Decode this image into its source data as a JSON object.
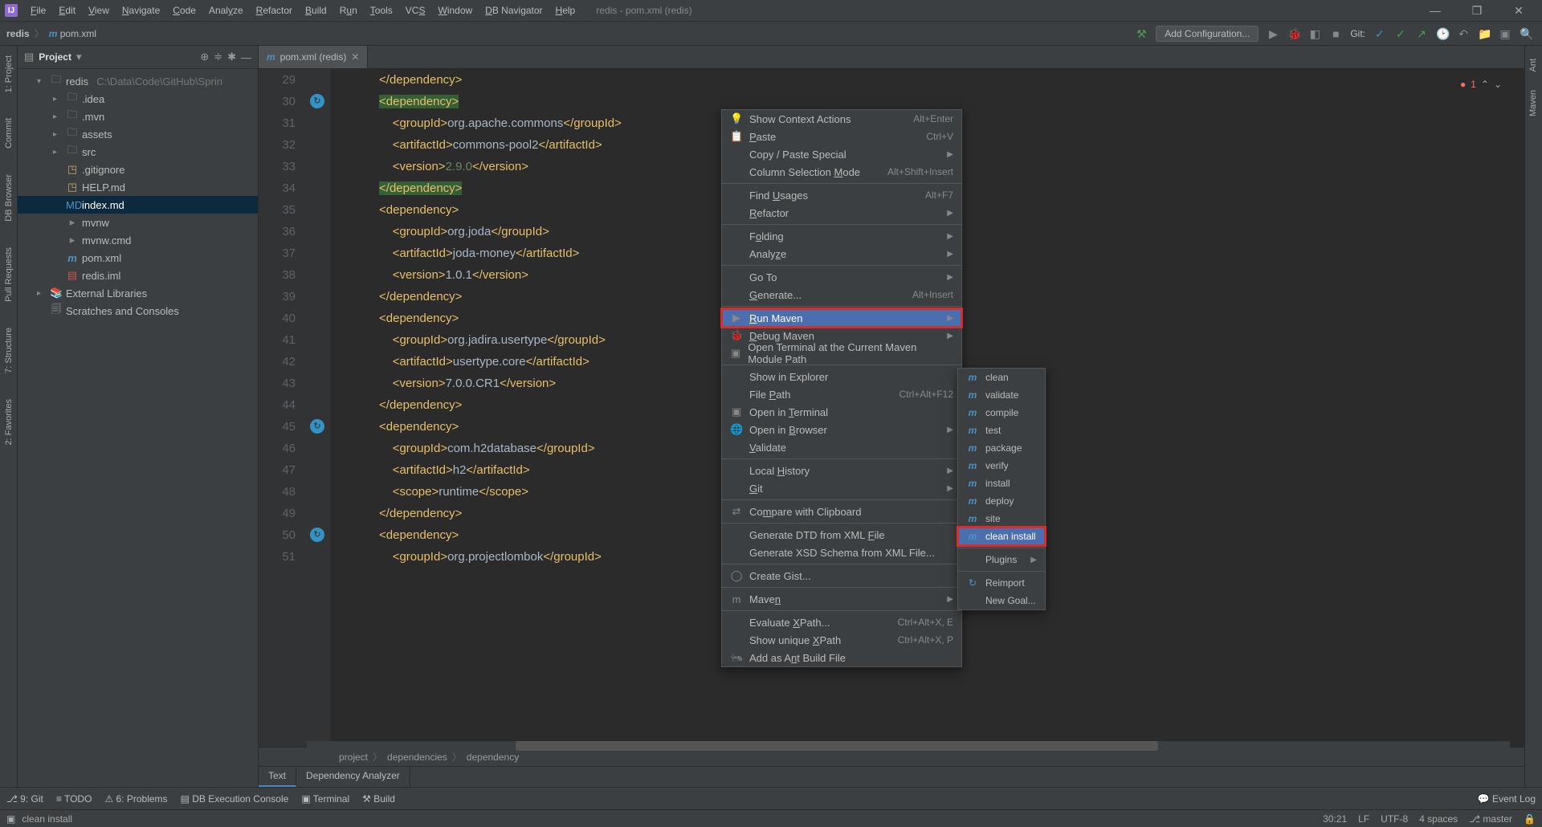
{
  "menubar": {
    "items": [
      "File",
      "Edit",
      "View",
      "Navigate",
      "Code",
      "Analyze",
      "Refactor",
      "Build",
      "Run",
      "Tools",
      "VCS",
      "Window",
      "DB Navigator",
      "Help"
    ],
    "underline_index": [
      0,
      0,
      0,
      0,
      0,
      4,
      0,
      0,
      1,
      0,
      2,
      0,
      0,
      0
    ]
  },
  "window_title": "redis - pom.xml (redis)",
  "breadcrumb": {
    "root": "redis",
    "file": "pom.xml"
  },
  "toolbar": {
    "add_configuration": "Add Configuration...",
    "git_label": "Git:"
  },
  "project_panel": {
    "title": "Project",
    "tree": {
      "root": {
        "name": "redis",
        "hint": "C:\\Data\\Code\\GitHub\\Sprin"
      },
      "folders": [
        ".idea",
        ".mvn",
        "assets",
        "src"
      ],
      "files": [
        {
          "name": ".gitignore",
          "icon": "golden"
        },
        {
          "name": "HELP.md",
          "icon": "golden"
        },
        {
          "name": "index.md",
          "icon": "md",
          "selected": true
        },
        {
          "name": "mvnw",
          "icon": "cmd"
        },
        {
          "name": "mvnw.cmd",
          "icon": "cmd"
        },
        {
          "name": "pom.xml",
          "icon": "m"
        },
        {
          "name": "redis.iml",
          "icon": "iml"
        }
      ],
      "libs": "External Libraries",
      "scratches": "Scratches and Consoles"
    }
  },
  "editor_tab": {
    "label": "pom.xml (redis)"
  },
  "error_count": "1",
  "code_lines": [
    {
      "n": 29,
      "indent": 3,
      "tokens": [
        {
          "t": "tag",
          "v": "</dependency>"
        }
      ]
    },
    {
      "n": 30,
      "indent": 3,
      "tokens": [
        {
          "t": "tag",
          "v": "<dependency>",
          "cls": "sel"
        }
      ],
      "marker": true
    },
    {
      "n": 31,
      "indent": 4,
      "tokens": [
        {
          "t": "tag",
          "v": "<groupId>"
        },
        {
          "t": "txt",
          "v": "org.apache.commons"
        },
        {
          "t": "tag",
          "v": "</groupId>"
        }
      ]
    },
    {
      "n": 32,
      "indent": 4,
      "tokens": [
        {
          "t": "tag",
          "v": "<artifactId>"
        },
        {
          "t": "txt",
          "v": "commons-pool2"
        },
        {
          "t": "tag",
          "v": "</artifactId>"
        }
      ]
    },
    {
      "n": 33,
      "indent": 4,
      "tokens": [
        {
          "t": "tag",
          "v": "<version>"
        },
        {
          "t": "ver",
          "v": "2.9.0"
        },
        {
          "t": "tag",
          "v": "</version>"
        }
      ]
    },
    {
      "n": 34,
      "indent": 3,
      "tokens": [
        {
          "t": "tag",
          "v": "</dependency>",
          "cls": "sel"
        }
      ]
    },
    {
      "n": 35,
      "indent": 3,
      "tokens": [
        {
          "t": "tag",
          "v": "<dependency>"
        }
      ]
    },
    {
      "n": 36,
      "indent": 4,
      "tokens": [
        {
          "t": "tag",
          "v": "<groupId>"
        },
        {
          "t": "txt",
          "v": "org.joda"
        },
        {
          "t": "tag",
          "v": "</groupId>"
        }
      ]
    },
    {
      "n": 37,
      "indent": 4,
      "tokens": [
        {
          "t": "tag",
          "v": "<artifactId>"
        },
        {
          "t": "txt",
          "v": "joda-money"
        },
        {
          "t": "tag",
          "v": "</artifactId>"
        }
      ]
    },
    {
      "n": 38,
      "indent": 4,
      "tokens": [
        {
          "t": "tag",
          "v": "<version>"
        },
        {
          "t": "txt",
          "v": "1.0.1"
        },
        {
          "t": "tag",
          "v": "</version>"
        }
      ]
    },
    {
      "n": 39,
      "indent": 3,
      "tokens": [
        {
          "t": "tag",
          "v": "</dependency>"
        }
      ]
    },
    {
      "n": 40,
      "indent": 3,
      "tokens": [
        {
          "t": "tag",
          "v": "<dependency>"
        }
      ]
    },
    {
      "n": 41,
      "indent": 4,
      "tokens": [
        {
          "t": "tag",
          "v": "<groupId>"
        },
        {
          "t": "txt",
          "v": "org.jadira.usertype"
        },
        {
          "t": "tag",
          "v": "</groupId>"
        }
      ]
    },
    {
      "n": 42,
      "indent": 4,
      "tokens": [
        {
          "t": "tag",
          "v": "<artifactId>"
        },
        {
          "t": "txt",
          "v": "usertype.core"
        },
        {
          "t": "tag",
          "v": "</artifactId>"
        }
      ]
    },
    {
      "n": 43,
      "indent": 4,
      "tokens": [
        {
          "t": "tag",
          "v": "<version>"
        },
        {
          "t": "txt",
          "v": "7.0.0.CR1"
        },
        {
          "t": "tag",
          "v": "</version>"
        }
      ]
    },
    {
      "n": 44,
      "indent": 3,
      "tokens": [
        {
          "t": "tag",
          "v": "</dependency>"
        }
      ]
    },
    {
      "n": 45,
      "indent": 3,
      "tokens": [
        {
          "t": "tag",
          "v": "<dependency>"
        }
      ],
      "marker": true
    },
    {
      "n": 46,
      "indent": 4,
      "tokens": [
        {
          "t": "tag",
          "v": "<groupId>"
        },
        {
          "t": "txt",
          "v": "com.h2database"
        },
        {
          "t": "tag",
          "v": "</groupId>"
        }
      ]
    },
    {
      "n": 47,
      "indent": 4,
      "tokens": [
        {
          "t": "tag",
          "v": "<artifactId>"
        },
        {
          "t": "txt",
          "v": "h2"
        },
        {
          "t": "tag",
          "v": "</artifactId>"
        }
      ]
    },
    {
      "n": 48,
      "indent": 4,
      "tokens": [
        {
          "t": "tag",
          "v": "<scope>"
        },
        {
          "t": "txt",
          "v": "runtime"
        },
        {
          "t": "tag",
          "v": "</scope>"
        }
      ]
    },
    {
      "n": 49,
      "indent": 3,
      "tokens": [
        {
          "t": "tag",
          "v": "</dependency>"
        }
      ]
    },
    {
      "n": 50,
      "indent": 3,
      "tokens": [
        {
          "t": "tag",
          "v": "<dependency>"
        }
      ],
      "marker": true
    },
    {
      "n": 51,
      "indent": 4,
      "tokens": [
        {
          "t": "tag",
          "v": "<groupId>"
        },
        {
          "t": "txt",
          "v": "org.projectlombok"
        },
        {
          "t": "tag",
          "v": "</groupId>"
        }
      ]
    }
  ],
  "editor_breadcrumb": [
    "project",
    "dependencies",
    "dependency"
  ],
  "editor_sub_tabs": [
    "Text",
    "Dependency Analyzer"
  ],
  "context_menu": [
    {
      "icon": "💡",
      "label": "Show Context Actions",
      "sc": "Alt+Enter"
    },
    {
      "icon": "📋",
      "label": "Paste",
      "sc": "Ctrl+V",
      "u": 0
    },
    {
      "label": "Copy / Paste Special",
      "sub": true
    },
    {
      "label": "Column Selection Mode",
      "sc": "Alt+Shift+Insert",
      "u": 17
    },
    {
      "sep": true
    },
    {
      "label": "Find Usages",
      "sc": "Alt+F7",
      "u": 5
    },
    {
      "label": "Refactor",
      "sub": true,
      "u": 0
    },
    {
      "sep": true
    },
    {
      "label": "Folding",
      "sub": true,
      "u": 1
    },
    {
      "label": "Analyze",
      "sub": true,
      "u": 5
    },
    {
      "sep": true
    },
    {
      "label": "Go To",
      "sub": true
    },
    {
      "label": "Generate...",
      "sc": "Alt+Insert",
      "u": 0
    },
    {
      "sep": true
    },
    {
      "icon": "▶",
      "label": "Run Maven",
      "sub": true,
      "hover": true,
      "red": true,
      "u": 0
    },
    {
      "icon": "🐞",
      "label": "Debug Maven",
      "sub": true,
      "u": 0
    },
    {
      "icon": "▣",
      "label": "Open Terminal at the Current Maven Module Path"
    },
    {
      "sep": true
    },
    {
      "label": "Show in Explorer"
    },
    {
      "label": "File Path",
      "sc": "Ctrl+Alt+F12",
      "u": 5
    },
    {
      "icon": "▣",
      "label": "Open in Terminal",
      "u": 8
    },
    {
      "icon": "🌐",
      "label": "Open in Browser",
      "sub": true,
      "u": 8
    },
    {
      "label": "Validate",
      "u": 0
    },
    {
      "sep": true
    },
    {
      "label": "Local History",
      "sub": true,
      "u": 6
    },
    {
      "label": "Git",
      "sub": true,
      "u": 0
    },
    {
      "sep": true
    },
    {
      "icon": "⇄",
      "label": "Compare with Clipboard",
      "u": 2
    },
    {
      "sep": true
    },
    {
      "label": "Generate DTD from XML File",
      "u": 22
    },
    {
      "label": "Generate XSD Schema from XML File..."
    },
    {
      "sep": true
    },
    {
      "icon": "◯",
      "label": "Create Gist..."
    },
    {
      "sep": true
    },
    {
      "icon": "m",
      "label": "Maven",
      "sub": true,
      "u": 4
    },
    {
      "sep": true
    },
    {
      "label": "Evaluate XPath...",
      "sc": "Ctrl+Alt+X, E",
      "u": 9
    },
    {
      "label": "Show unique XPath",
      "sc": "Ctrl+Alt+X, P",
      "u": 12
    },
    {
      "icon": "🐜",
      "label": "Add as Ant Build File",
      "u": 8
    }
  ],
  "submenu": {
    "items": [
      "clean",
      "validate",
      "compile",
      "test",
      "package",
      "verify",
      "install",
      "deploy",
      "site",
      "clean install"
    ],
    "plugins": "Plugins",
    "reimport": "Reimport",
    "newgoal": "New Goal...",
    "selected": "clean install"
  },
  "bottom_tools": {
    "git": "9: Git",
    "todo": "TODO",
    "problems": "6: Problems",
    "db": "DB Execution Console",
    "terminal": "Terminal",
    "build": "Build",
    "eventlog": "Event Log"
  },
  "statusbar": {
    "cmd": "clean install",
    "pos": "30:21",
    "le": "LF",
    "enc": "UTF-8",
    "indent": "4 spaces",
    "branch": "master"
  },
  "left_gutter_labels": [
    "1: Project",
    "Commit",
    "DB Browser",
    "Pull Requests",
    "7: Structure",
    "2: Favorites"
  ],
  "right_gutter_labels": [
    "Ant",
    "Maven"
  ]
}
